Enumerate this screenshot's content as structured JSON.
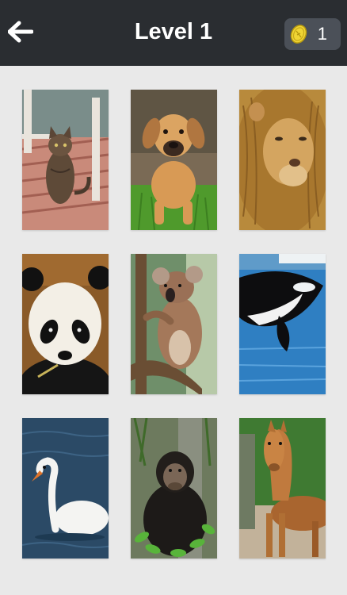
{
  "header": {
    "title": "Level 1",
    "coins": "1",
    "back_icon": "arrow-left-icon",
    "coin_icon": "gold-coin-icon"
  },
  "colors": {
    "header_bg": "#2a2d31",
    "badge_bg": "#4b5058",
    "page_bg": "#e9e9e9",
    "coin_gold": "#f0d534"
  },
  "animals": [
    "cat",
    "dog",
    "lion",
    "panda",
    "koala",
    "orca",
    "swan",
    "chimpanzee",
    "horse"
  ]
}
